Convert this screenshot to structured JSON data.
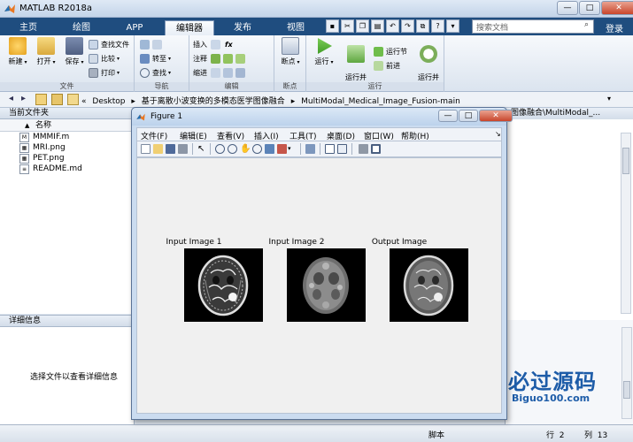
{
  "window": {
    "title": "MATLAB R2018a",
    "minimize": "—",
    "maximize": "□",
    "close": "✕"
  },
  "ribbon_tabs": [
    {
      "label": "主页"
    },
    {
      "label": "绘图"
    },
    {
      "label": "APP"
    },
    {
      "label": "编辑器",
      "active": true
    },
    {
      "label": "发布"
    },
    {
      "label": "视图"
    }
  ],
  "search": {
    "placeholder": "搜索文档",
    "icon": "search-icon"
  },
  "login": "登录",
  "ribbon": {
    "file": {
      "label": "文件",
      "new": "新建",
      "open": "打开",
      "save": "保存",
      "find_files": "查找文件",
      "compare": "比较",
      "print": "打印"
    },
    "nav": {
      "label": "导航",
      "goto": "转至",
      "find": "查找"
    },
    "edit": {
      "label": "编辑",
      "insert": "插入",
      "comment": "注释",
      "indent": "缩进",
      "fx": "fx"
    },
    "breakpoints": {
      "label": "断点",
      "breakpoints": "断点"
    },
    "run": {
      "label": "运行",
      "run": "运行",
      "run_advance": "运行并\n前进",
      "run_section": "运行节",
      "advance": "前进",
      "run_time": "运行并\n计时"
    }
  },
  "address": {
    "path": [
      "«",
      "Desktop",
      "▸",
      "基于离散小波变换的多模态医学图像融合",
      "▸",
      "MultiModal_Medical_Image_Fusion-main"
    ],
    "dropdown": "▾"
  },
  "current_folder": {
    "title": "当前文件夹",
    "column": "名称",
    "sort_arrow": "▲",
    "files": [
      {
        "name": "MMMIF.m",
        "icon": "m-file-icon",
        "glyph": "M"
      },
      {
        "name": "MRI.png",
        "icon": "image-file-icon",
        "glyph": "▦"
      },
      {
        "name": "PET.png",
        "icon": "image-file-icon",
        "glyph": "▦"
      },
      {
        "name": "README.md",
        "icon": "text-file-icon",
        "glyph": "≡"
      }
    ]
  },
  "details": {
    "title": "详细信息",
    "placeholder": "选择文件以查看详细信息"
  },
  "right_panel": {
    "header": "图像融合\\MultiModal_..."
  },
  "status": {
    "script": "脚本",
    "row_label": "行",
    "row": "2",
    "col_label": "列",
    "col": "13"
  },
  "figure": {
    "title": "Figure 1",
    "menus": [
      "文件(F)",
      "编辑(E)",
      "查看(V)",
      "插入(I)",
      "工具(T)",
      "桌面(D)",
      "窗口(W)",
      "帮助(H)"
    ],
    "axes": [
      {
        "title": "Input Image 1"
      },
      {
        "title": "Input Image 2"
      },
      {
        "title": "Output Image"
      }
    ]
  },
  "watermark": {
    "cn": "必过源码",
    "en": "Biguo100.com"
  }
}
